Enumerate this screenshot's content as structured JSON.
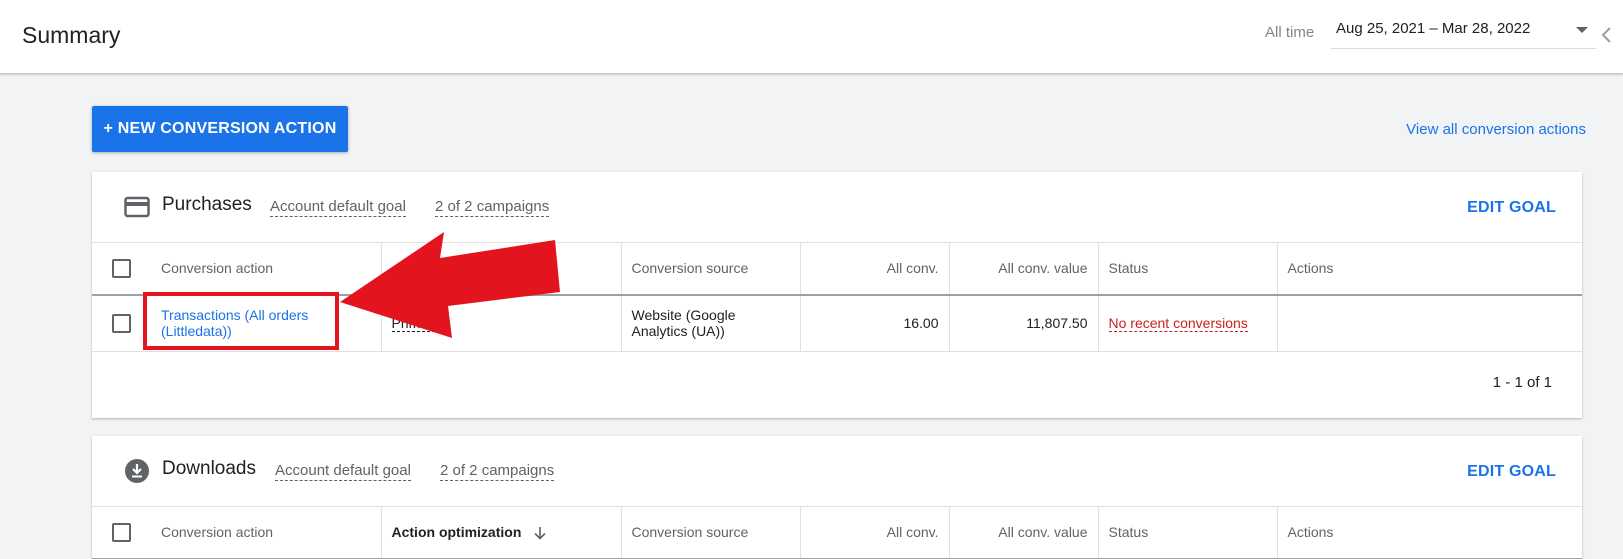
{
  "header": {
    "title": "Summary",
    "date_label": "All time",
    "date_range": "Aug 25, 2021 – Mar 28, 2022"
  },
  "toolbar": {
    "new_action_label": "+ NEW CONVERSION ACTION",
    "view_all_label": "View all conversion actions"
  },
  "goals": [
    {
      "title": "Purchases",
      "icon": "credit-card-icon",
      "default_goal": "Account default goal",
      "campaigns": "2 of 2 campaigns",
      "edit_label": "EDIT GOAL",
      "columns": {
        "action": "Conversion action",
        "optimization": "",
        "source": "Conversion source",
        "all_conv": "All conv.",
        "all_conv_value": "All conv. value",
        "status": "Status",
        "actions": "Actions"
      },
      "rows": [
        {
          "action": "Transactions (All orders (Littledata))",
          "optimization": "Primary",
          "source": "Website (Google Analytics (UA))",
          "all_conv": "16.00",
          "all_conv_value": "11,807.50",
          "status": "No recent conversions",
          "actions": ""
        }
      ],
      "pagination": "1 - 1 of 1"
    },
    {
      "title": "Downloads",
      "icon": "download-circle-icon",
      "default_goal": "Account default goal",
      "campaigns": "2 of 2 campaigns",
      "edit_label": "EDIT GOAL",
      "columns": {
        "action": "Conversion action",
        "optimization": "Action optimization",
        "source": "Conversion source",
        "all_conv": "All conv.",
        "all_conv_value": "All conv. value",
        "status": "Status",
        "actions": "Actions"
      }
    }
  ],
  "colors": {
    "accent": "#1a73e8",
    "annotation_red": "#e3141e",
    "status_red": "#c5221f"
  }
}
